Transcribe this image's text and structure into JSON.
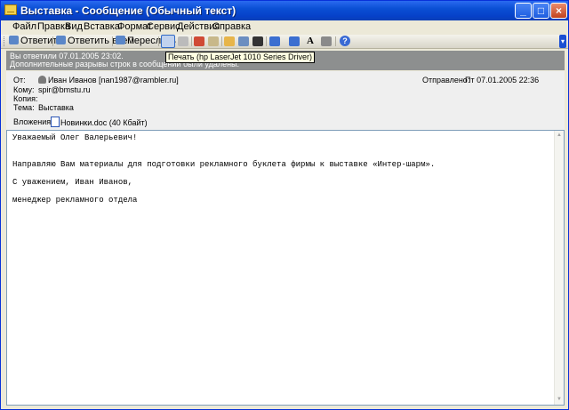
{
  "window": {
    "title": "Выставка - Сообщение (Обычный текст)",
    "controls": {
      "minimize": "_",
      "maximize": "□",
      "close": "×"
    }
  },
  "menu": [
    "Файл",
    "Правка",
    "Вид",
    "Вставка",
    "Формат",
    "Сервис",
    "Действия",
    "Справка"
  ],
  "toolbar": {
    "reply": "Ответить",
    "reply_all": "Ответить всем",
    "forward": "Переслать",
    "font_size_icon": "A",
    "help_icon": "?"
  },
  "tooltip": "Печать (hp LaserJet 1010 Series Driver)",
  "infobar": {
    "line1": "Вы ответили 07.01.2005 23:02.",
    "line2": "Дополнительные разрывы строк в сообщении были удалены."
  },
  "header": {
    "from_label": "От:",
    "from_value": "Иван Иванов [nan1987@rambler.ru]",
    "to_label": "Кому:",
    "to_value": "spir@bmstu.ru",
    "cc_label": "Копия:",
    "cc_value": "",
    "subject_label": "Тема:",
    "subject_value": "Выставка",
    "sent_label": "Отправлено:",
    "sent_value": "Пт 07.01.2005 22:36",
    "attachments_label": "Вложения:",
    "attachment": "Новинки.doc (40 Кбайт)"
  },
  "body": {
    "greeting": "Уважаемый Олег Валерьевич!",
    "paragraph": "Направляю Вам материалы для подготовки рекламного буклета фирмы к выставке «Интер-шарм».",
    "closing": "С уважением, Иван Иванов,",
    "signature": "менеджер рекламного отдела"
  }
}
